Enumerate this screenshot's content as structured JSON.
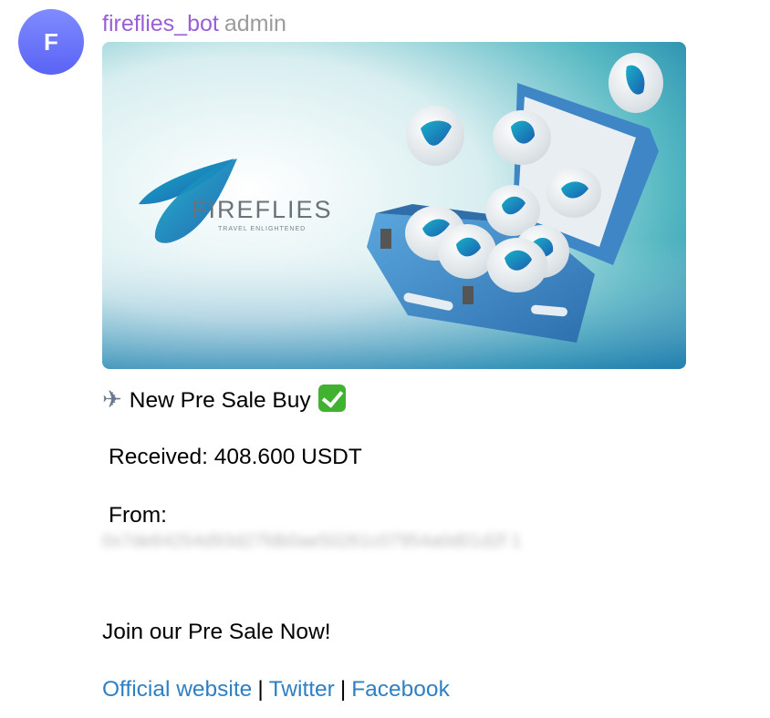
{
  "avatar": {
    "letter": "F"
  },
  "header": {
    "sender": "fireflies_bot",
    "role": "admin"
  },
  "image": {
    "brand": "FIREFLIES",
    "tagline": "TRAVEL ENLIGHTENED"
  },
  "message": {
    "plane_icon": "airplane-icon",
    "title": "New Pre Sale Buy",
    "check_icon": "check-mark-icon",
    "received": "Received: 408.600 USDT",
    "from_label": "From:",
    "from_address": "0x7de64254d93d27fdb0ae50261c07954a0d01d2f\n1",
    "cta": "Join our Pre Sale Now!"
  },
  "links": {
    "official": "Official website",
    "twitter": "Twitter",
    "facebook": "Facebook",
    "separator": "|"
  },
  "colors": {
    "link": "#2f7fc4",
    "sender": "#9a5fd6",
    "role": "#9b9b9b"
  }
}
